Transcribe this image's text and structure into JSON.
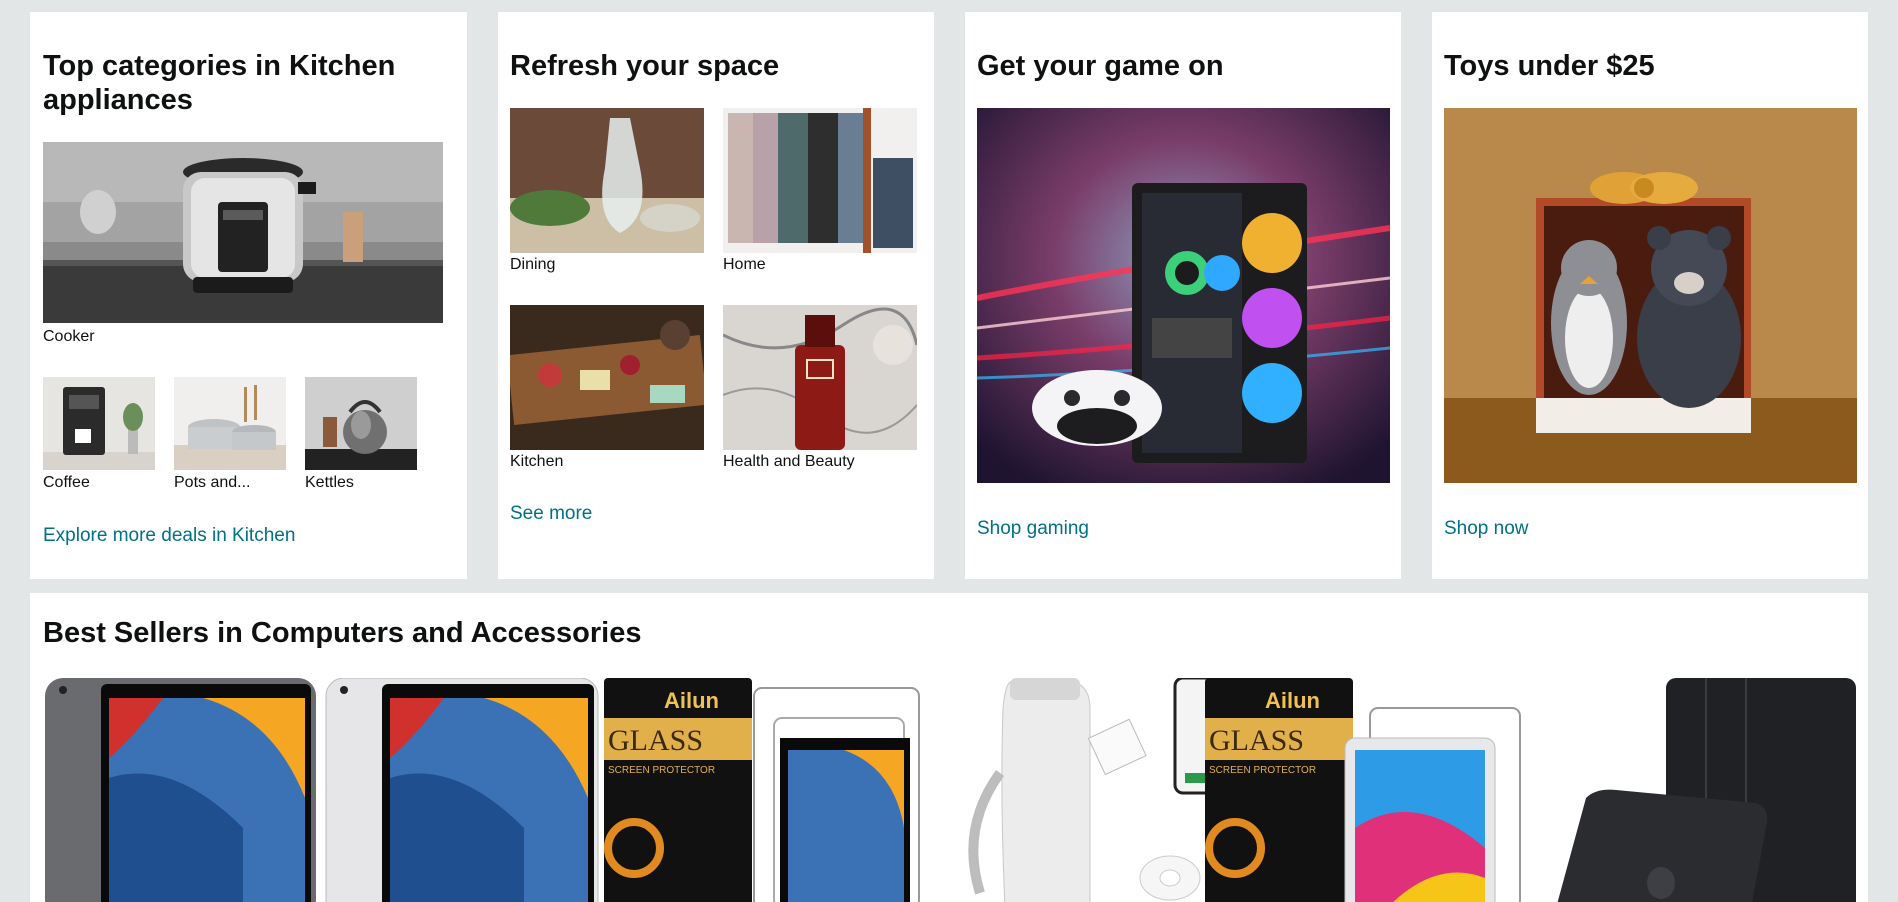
{
  "cards": {
    "kitchen": {
      "title": "Top categories in Kitchen appliances",
      "main_caption": "Cooker",
      "items": [
        {
          "label": "Coffee"
        },
        {
          "label": "Pots and..."
        },
        {
          "label": "Kettles"
        }
      ],
      "link": "Explore more deals in Kitchen"
    },
    "refresh": {
      "title": "Refresh your space",
      "items": [
        {
          "label": "Dining"
        },
        {
          "label": "Home"
        },
        {
          "label": "Kitchen"
        },
        {
          "label": "Health and Beauty"
        }
      ],
      "link": "See more"
    },
    "gaming": {
      "title": "Get your game on",
      "link": "Shop gaming"
    },
    "toys": {
      "title": "Toys under $25",
      "link": "Shop now"
    }
  },
  "bestsellers": {
    "title": "Best Sellers in Computers and Accessories",
    "brand_label": "Ailun",
    "glass_label": "GLASS",
    "protector_label": "SCREEN PROTECTOR",
    "products": [
      {
        "name": "ipad-space-gray"
      },
      {
        "name": "ipad-silver"
      },
      {
        "name": "ailun-screen-protector"
      },
      {
        "name": "label-maker"
      },
      {
        "name": "ailun-screen-protector-2"
      },
      {
        "name": "tablet-case"
      }
    ]
  },
  "colors": {
    "link": "#007185",
    "page_bg": "#e3e6e6",
    "text": "#0f1111"
  }
}
